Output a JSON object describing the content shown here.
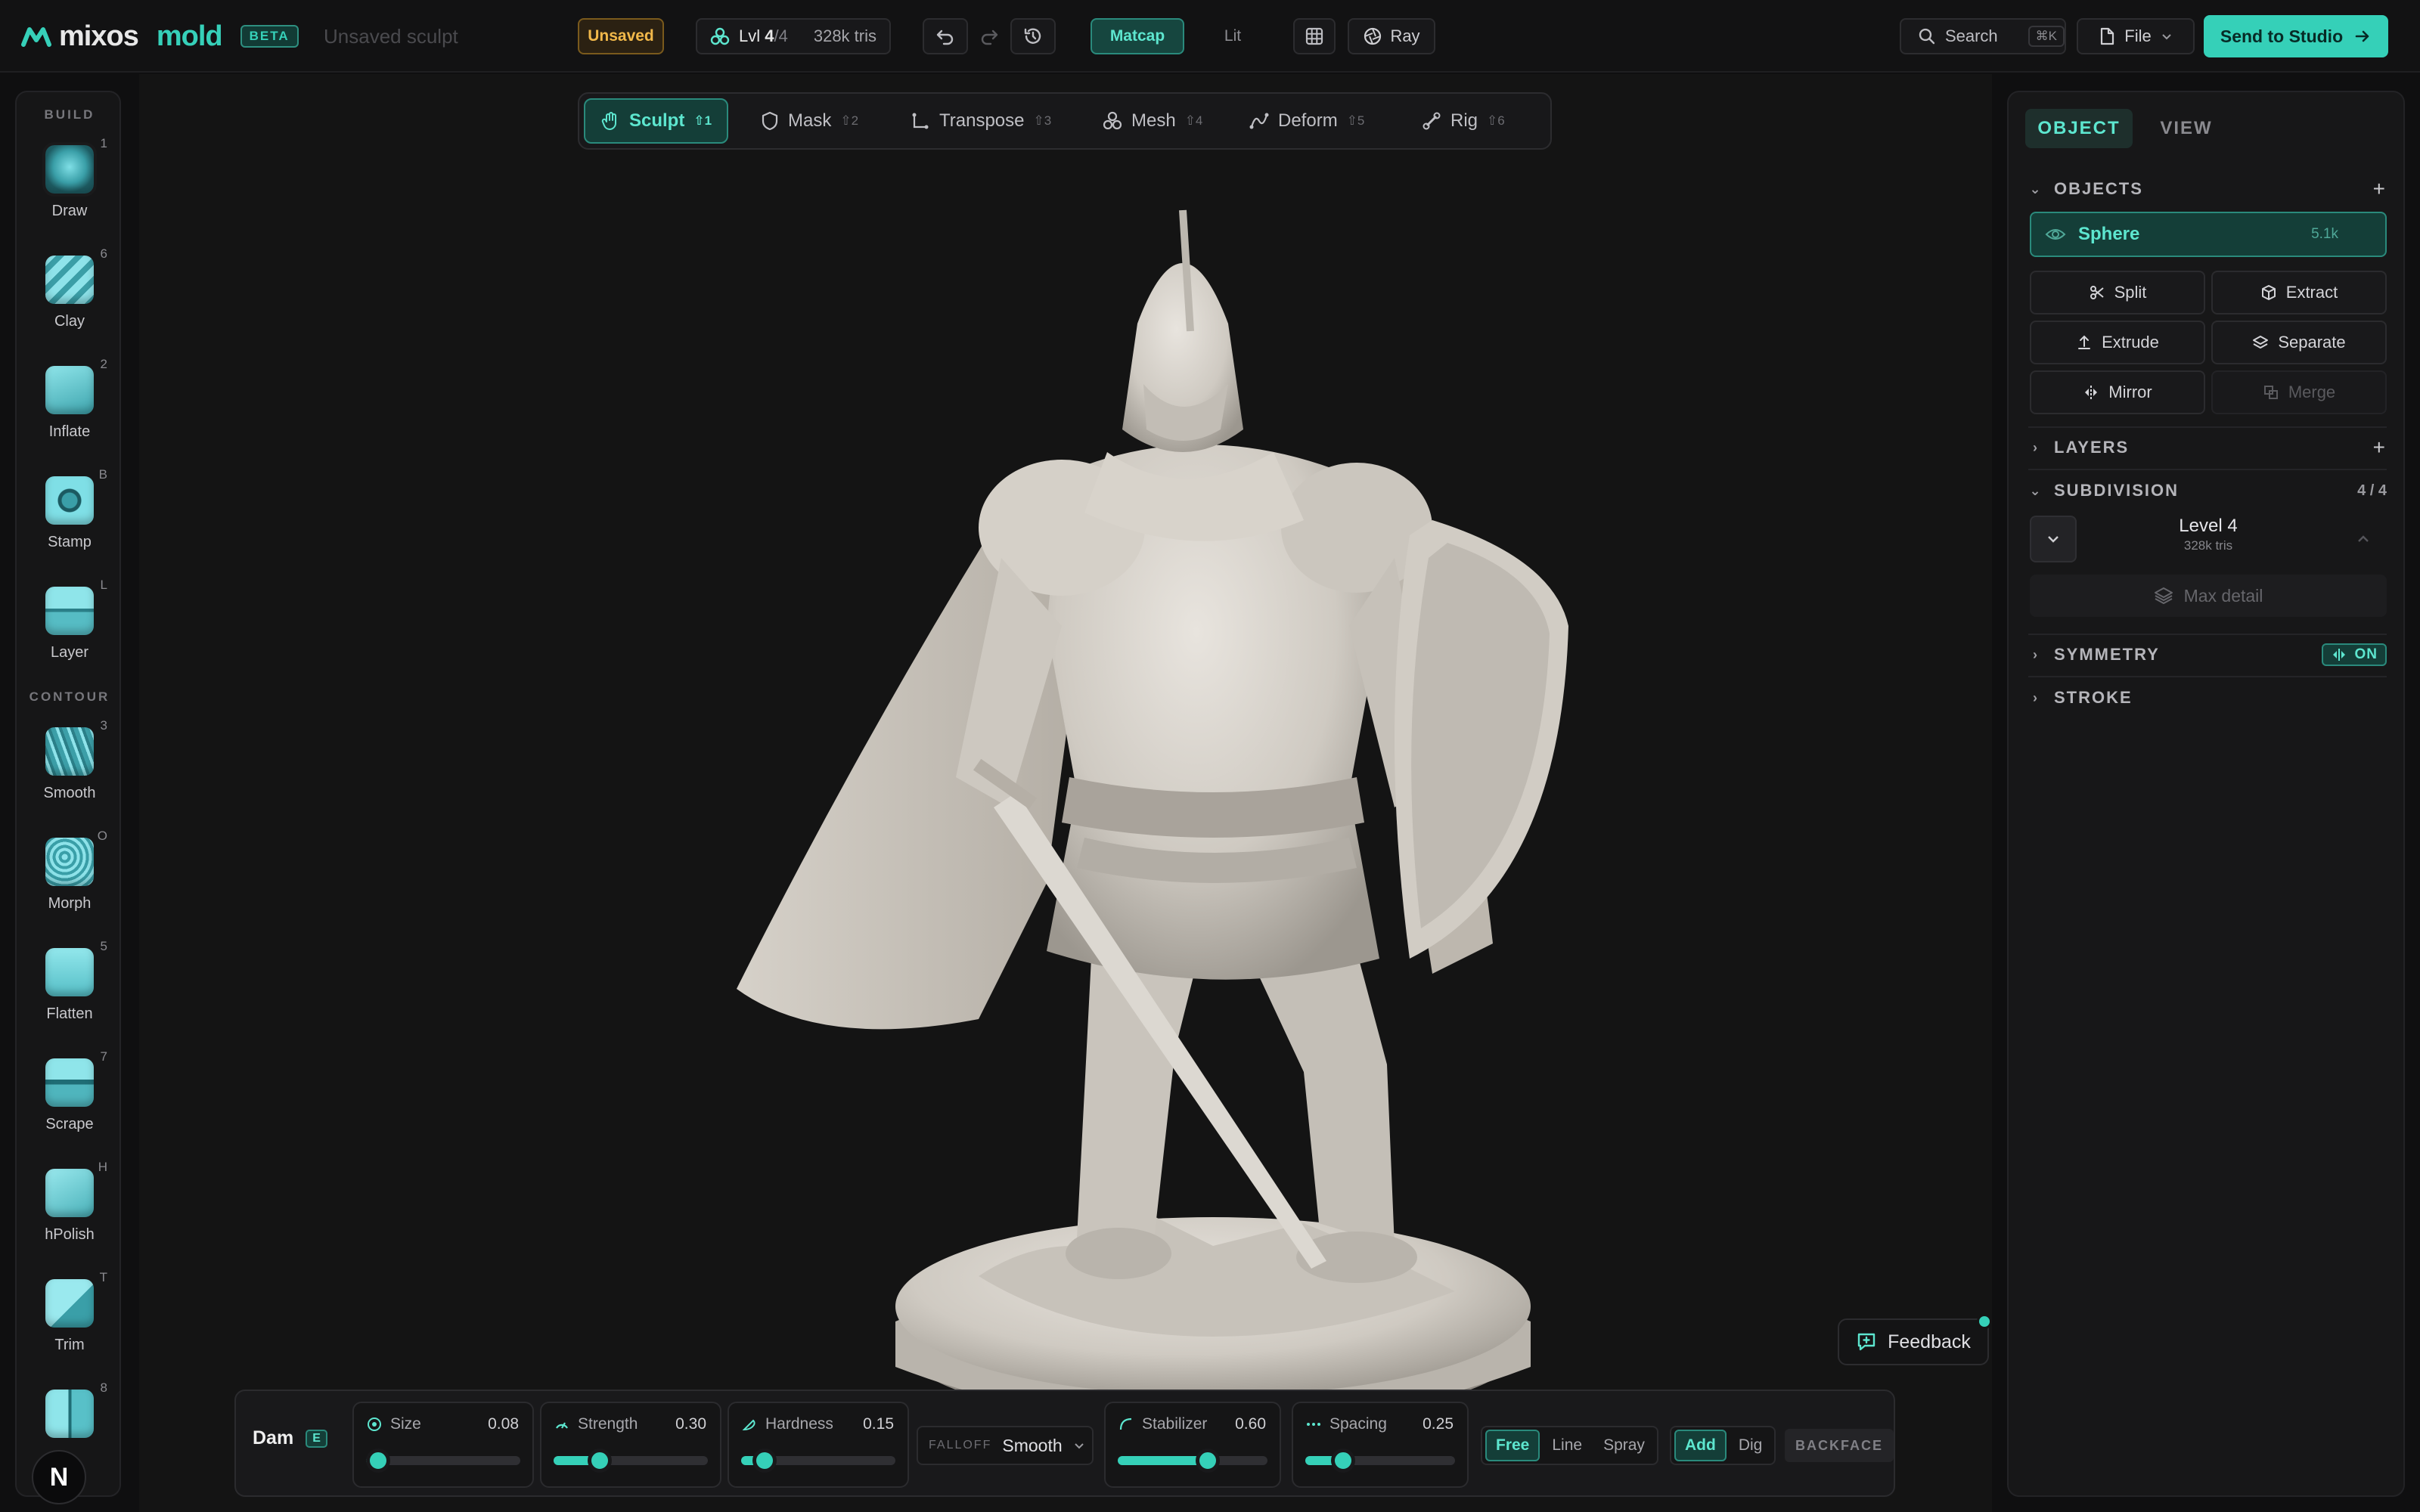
{
  "app": {
    "logo": "mixos",
    "product": "mold",
    "badge": "BETA",
    "document_title": "Unsaved sculpt",
    "save_status": "Unsaved"
  },
  "topbar": {
    "level_prefix": "Lvl",
    "level_current": "4",
    "level_total": "/4",
    "tris": "328k tris",
    "shading_modes": [
      "Matcap",
      "Lit"
    ],
    "shading_active": "Matcap",
    "render_label": "Ray",
    "search_label": "Search",
    "search_shortcut": "⌘K",
    "file_label": "File",
    "send_label": "Send to Studio"
  },
  "left_toolbar": {
    "build_header": "BUILD",
    "contour_header": "CONTOUR",
    "build_tools": [
      {
        "label": "Draw",
        "key": "1"
      },
      {
        "label": "Clay",
        "key": "6"
      },
      {
        "label": "Inflate",
        "key": "2"
      },
      {
        "label": "Stamp",
        "key": "B"
      },
      {
        "label": "Layer",
        "key": "L"
      }
    ],
    "contour_tools": [
      {
        "label": "Smooth",
        "key": "3"
      },
      {
        "label": "Morph",
        "key": "O"
      },
      {
        "label": "Flatten",
        "key": "5"
      },
      {
        "label": "Scrape",
        "key": "7"
      },
      {
        "label": "hPolish",
        "key": "H"
      },
      {
        "label": "Trim",
        "key": "T"
      },
      {
        "label": "",
        "key": "8"
      }
    ],
    "user_initial": "N"
  },
  "modes": [
    {
      "label": "Sculpt",
      "key": "⇧1"
    },
    {
      "label": "Mask",
      "key": "⇧2"
    },
    {
      "label": "Transpose",
      "key": "⇧3"
    },
    {
      "label": "Mesh",
      "key": "⇧4"
    },
    {
      "label": "Deform",
      "key": "⇧5"
    },
    {
      "label": "Rig",
      "key": "⇧6"
    }
  ],
  "feedback_label": "Feedback",
  "brush": {
    "name": "Dam",
    "key": "E",
    "size": {
      "label": "Size",
      "value": "0.08",
      "fraction": 0.08
    },
    "strength": {
      "label": "Strength",
      "value": "0.30",
      "fraction": 0.3
    },
    "hardness": {
      "label": "Hardness",
      "value": "0.15",
      "fraction": 0.15
    },
    "falloff_label": "FALLOFF",
    "falloff_value": "Smooth",
    "stabilizer": {
      "label": "Stabilizer",
      "value": "0.60",
      "fraction": 0.6
    },
    "spacing": {
      "label": "Spacing",
      "value": "0.25",
      "fraction": 0.25
    },
    "stroke_modes": [
      "Free",
      "Line",
      "Spray"
    ],
    "stroke_active": "Free",
    "direction_modes": [
      "Add",
      "Dig"
    ],
    "direction_active": "Add",
    "backface_label": "BACKFACE"
  },
  "right_panel": {
    "tabs": [
      "OBJECT",
      "VIEW"
    ],
    "objects_header": "OBJECTS",
    "object_name": "Sphere",
    "object_count": "5.1k",
    "actions": [
      "Split",
      "Extract",
      "Extrude",
      "Separate",
      "Mirror",
      "Merge"
    ],
    "layers_header": "LAYERS",
    "subdivision_header": "SUBDIVISION",
    "subdivision_count": "4 / 4",
    "subdivision_level": "Level 4",
    "subdivision_tris": "328k tris",
    "max_detail_label": "Max detail",
    "symmetry_header": "SYMMETRY",
    "symmetry_state": "ON",
    "stroke_header": "STROKE"
  },
  "colors": {
    "accent": "#35d0b8",
    "warning": "#f1b84a",
    "background": "#141414"
  }
}
